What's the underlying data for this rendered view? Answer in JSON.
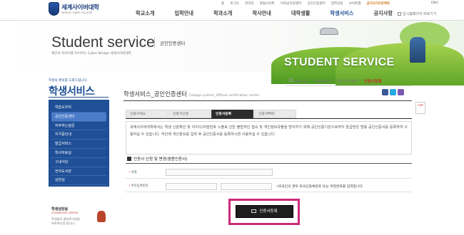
{
  "header": {
    "logo_name": "세계사이버대학",
    "logo_sub": "WORLD CYBER COLLEGE",
    "util_links": [
      "홈",
      "로그인",
      "관리자",
      "포털사이트",
      "이러닝지원센터",
      "공인인증센터",
      "입학상담",
      "사이트맵"
    ],
    "util_highlight": "공지3기프로젝트",
    "lang_link": "ENG",
    "gnb": [
      "학교소개",
      "입학안내",
      "학과소개",
      "학사안내",
      "대학생활",
      "학생서비스",
      "공지사항"
    ],
    "gnb_active_index": 5,
    "home_link": "입시홈페이지 바로가기"
  },
  "banner": {
    "title": "Student service",
    "subtitle": "공인인증센터",
    "description": "제인의 커리어를 이어주는 Cyber Bridge 세계사이버대학",
    "stamp": "STUDENT SERVICE"
  },
  "sidebar": {
    "small": "학생의 편의를 도와드립니다.",
    "title": "학생서비스",
    "items": [
      "학습도우미",
      "공인인증센터",
      "자주하는질문",
      "지극증안내",
      "발급서비스",
      "학사자료실",
      "구내식당",
      "전자도서관",
      "상담실"
    ],
    "selected_index": 1,
    "accent": "#1f4f96"
  },
  "counsel": {
    "title": "학생상담실",
    "subtitle": "COUNSELING CENTER",
    "line1": "학생들의 올바른사람을",
    "line2": "위하여선생 합니다."
  },
  "breadcrumb": [
    "WCC홈",
    "학생서비스",
    "공인인증센터",
    "인증서등록"
  ],
  "page": {
    "title": "학생서비스_공인인증센터",
    "title_en": "College system_Official certification center",
    "top_button": "TOP"
  },
  "tabs": [
    "인증서개요",
    "인증서신청",
    "인증서등록",
    "인증서FAQ"
  ],
  "active_tab": 2,
  "notice": "세계사이버대학에서는 학생 신분확인 및 아이디/비밀번호 노출로 인한 불법적인 접속 및 개인정보유출을 방지하기 위해 공인인증기관으로부터 발급받은 범용 공인인증서를 등록하여 사용하실 수 있습니다. 하단에 개인정보를 입력 후 공인인증서를 등록하시면 사용하실 수 있습니다.",
  "form": {
    "section_title": "인증서 신청 및 변경(범용인증서)",
    "name_label": "성명",
    "rrn_label": "주민등록번호",
    "rrn_note": "•외국인의 경우 외국인등록번호 또는 여권번호를 입력합니다.",
    "name_value": "",
    "rrn_front": "",
    "rrn_back": "",
    "submit_label": "인증서등록",
    "highlight_color": "#cc2a7a"
  }
}
